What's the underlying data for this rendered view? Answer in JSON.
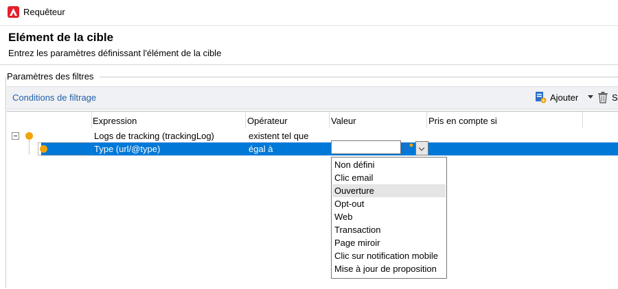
{
  "window": {
    "title": "Requêteur"
  },
  "header": {
    "title": "Elément de la cible",
    "subtitle": "Entrez les paramètres définissant l'élément de la cible"
  },
  "section": {
    "legend": "Paramètres des filtres"
  },
  "toolbar": {
    "title": "Conditions de filtrage",
    "add_label": "Ajouter",
    "delete_label": "S"
  },
  "grid": {
    "columns": [
      "Expression",
      "Opérateur",
      "Valeur",
      "Pris en compte si"
    ],
    "rows": [
      {
        "expression": "Logs de tracking (trackingLog)",
        "operator": "existent tel que",
        "value": "",
        "condition": ""
      },
      {
        "expression": "Type (url/@type)",
        "operator": "égal à",
        "value": "",
        "condition": ""
      }
    ]
  },
  "dropdown": {
    "options": [
      "Non défini",
      "Clic email",
      "Ouverture",
      "Opt-out",
      "Web",
      "Transaction",
      "Page miroir",
      "Clic sur notification mobile",
      "Mise à jour de proposition"
    ],
    "highlighted": "Ouverture"
  },
  "colors": {
    "selection": "#0078d7",
    "accent_link": "#1f5fa8",
    "tree_dot": "#f0a30a",
    "brand": "#e4202b"
  }
}
